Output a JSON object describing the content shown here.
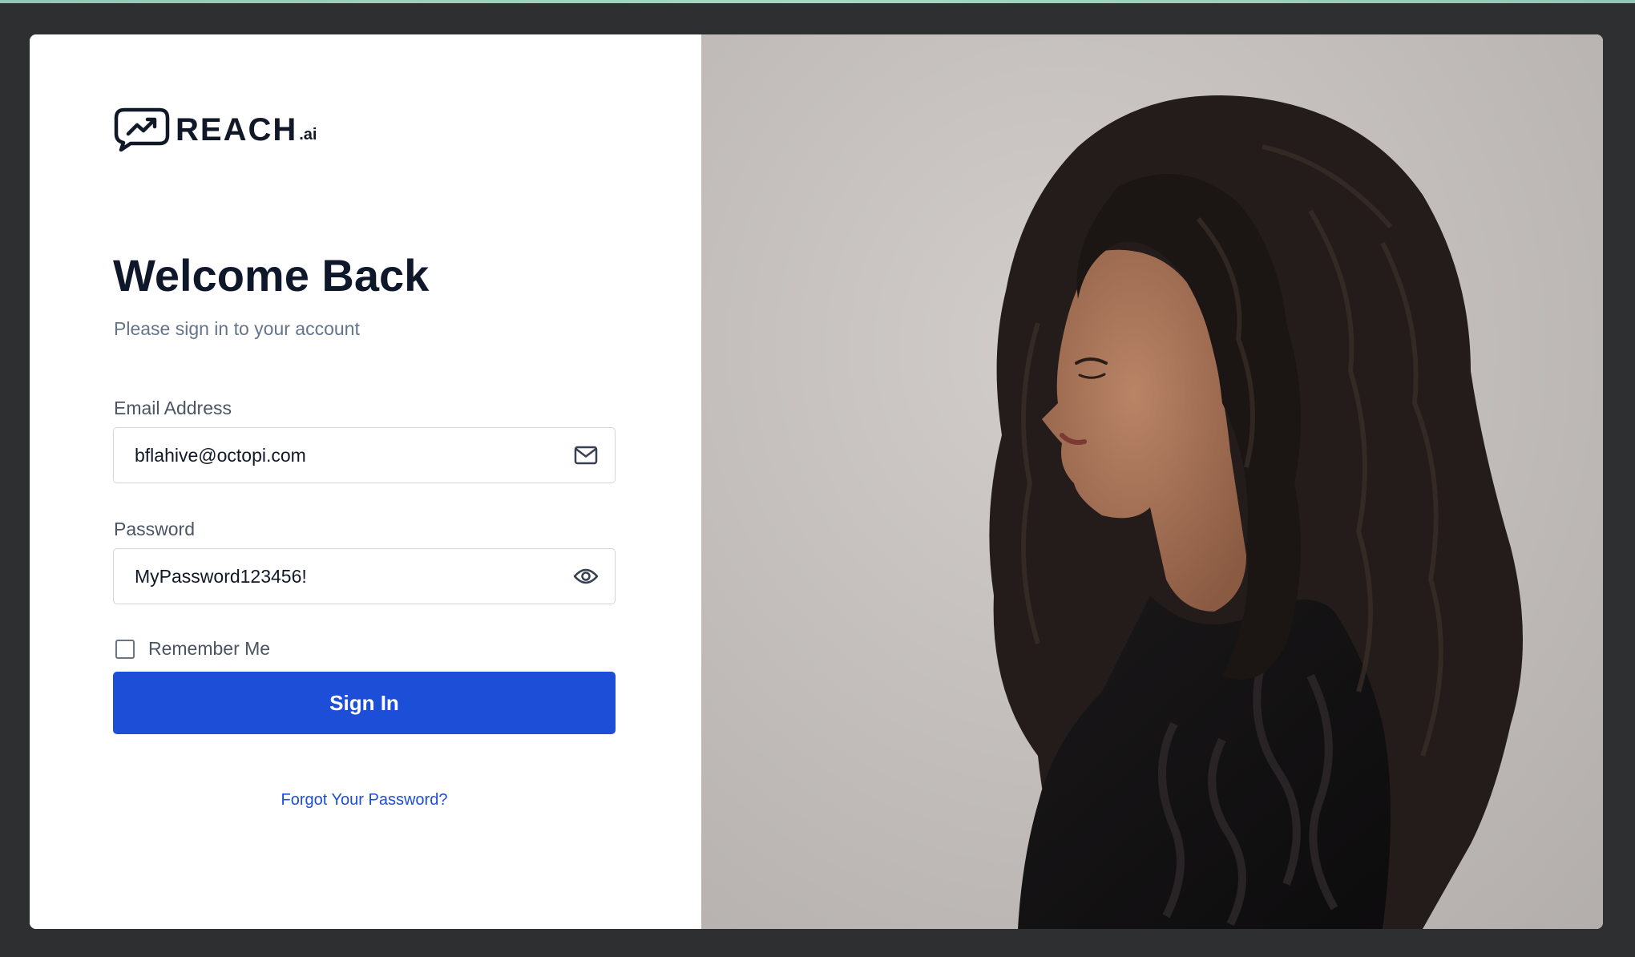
{
  "logo": {
    "brand": "REACH",
    "suffix": ".ai",
    "mark_icon": "chat-bubble-trending-up-icon"
  },
  "heading": "Welcome Back",
  "subheading": "Please sign in to your account",
  "email": {
    "label": "Email Address",
    "value": "bflahive@octopi.com",
    "icon": "mail-icon"
  },
  "password": {
    "label": "Password",
    "value": "MyPassword123456!",
    "icon": "eye-icon"
  },
  "remember": {
    "label": "Remember Me",
    "checked": false
  },
  "signin_label": "Sign In",
  "forgot_label": "Forgot Your Password?",
  "colors": {
    "primary": "#1d4ed8",
    "heading": "#0f172a",
    "page_background": "#2d2f31",
    "photo_background": "#c4bfbd"
  }
}
